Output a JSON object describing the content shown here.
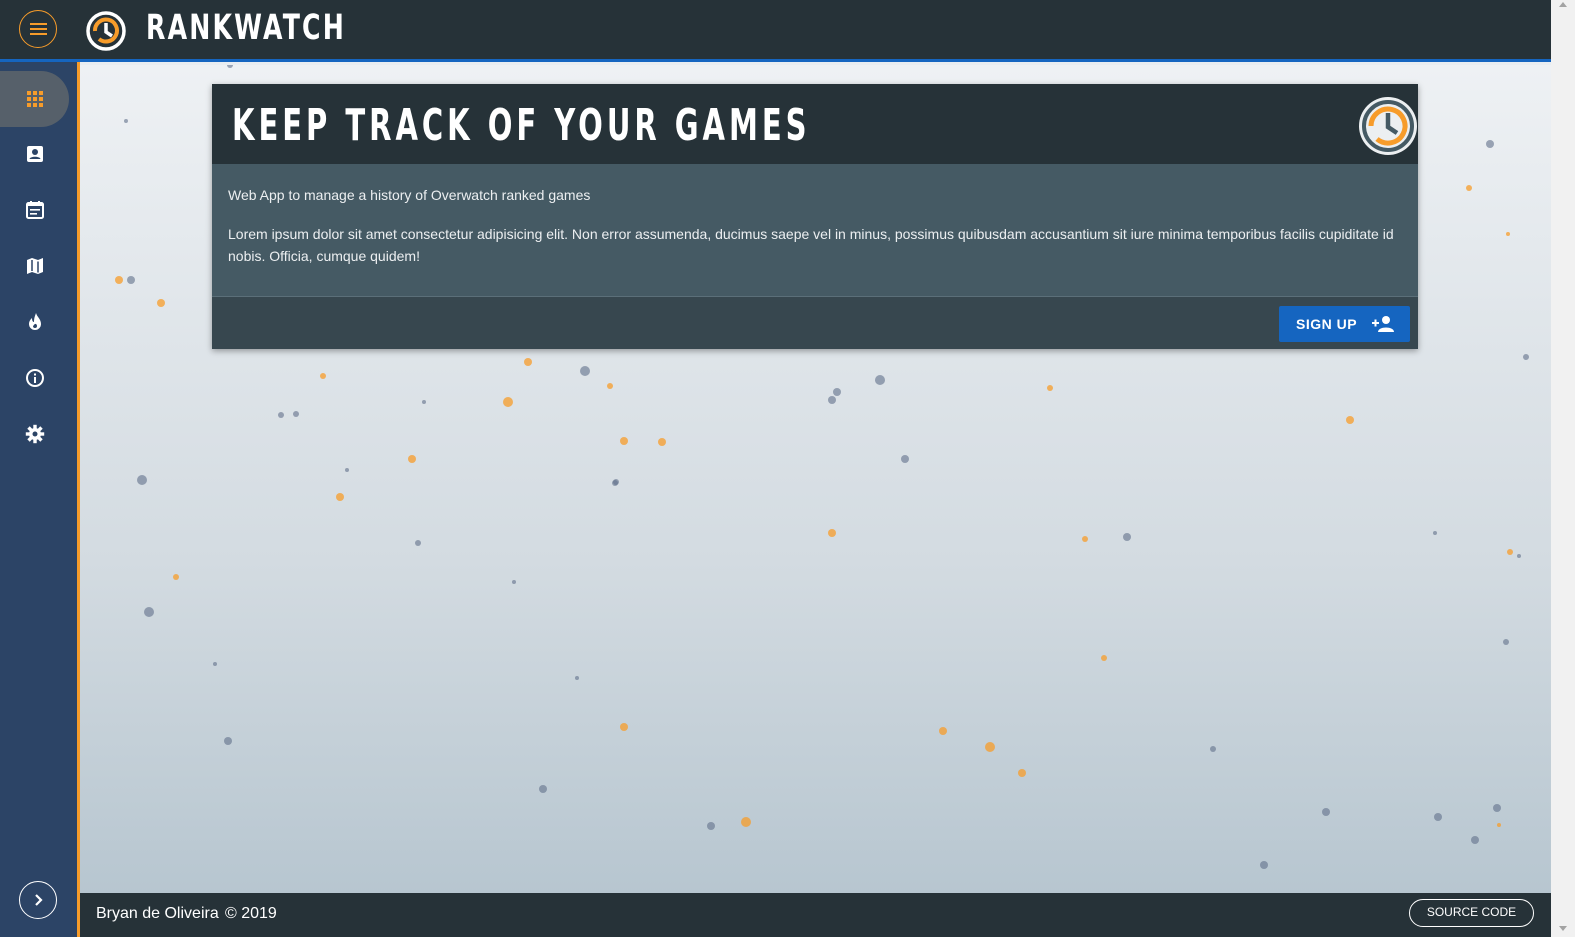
{
  "app": {
    "brand": "RANKWATCH"
  },
  "colors": {
    "accent": "#f79c2a",
    "primary": "#1565c0",
    "dark": "#263238",
    "sidebar": "#2c4466"
  },
  "topbar": {
    "menu_icon": "hamburger-menu-icon",
    "logo_icon": "overwatch-logo-icon"
  },
  "sidebar": {
    "items": [
      {
        "icon": "apps-grid-icon",
        "active": true
      },
      {
        "icon": "contact-card-icon",
        "active": false
      },
      {
        "icon": "calendar-icon",
        "active": false
      },
      {
        "icon": "map-icon",
        "active": false
      },
      {
        "icon": "fire-icon",
        "active": false
      },
      {
        "icon": "info-icon",
        "active": false
      },
      {
        "icon": "settings-gear-icon",
        "active": false
      }
    ],
    "collapse_icon": "chevron-right-icon"
  },
  "card": {
    "title": "KEEP TRACK OF YOUR GAMES",
    "subtitle": "Web App to manage a history of Overwatch ranked games",
    "description": "Lorem ipsum dolor sit amet consectetur adipisicing elit. Non error assumenda, ducimus saepe vel in minus, possimus quibusdam accusantium sit iure minima temporibus facilis cupiditate id nobis. Officia, cumque quidem!",
    "signup_label": "SIGN UP",
    "signup_icon": "add-person-icon"
  },
  "footer": {
    "author": "Bryan de Oliveira",
    "year": "© 2019",
    "source_label": "SOURCE CODE"
  }
}
